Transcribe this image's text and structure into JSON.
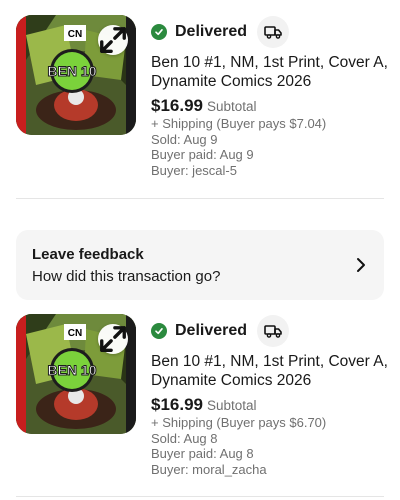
{
  "orders": [
    {
      "status": "Delivered",
      "title": "Ben 10 #1, NM, 1st Print, Cover A, Dynamite Comics 2026",
      "price": "$16.99",
      "price_label": "Subtotal",
      "shipping": "+ Shipping (Buyer pays $7.04)",
      "sold": "Sold: Aug 9",
      "paid": "Buyer paid: Aug 9",
      "buyer": "Buyer: jescal-5",
      "image_text": {
        "brand": "CN",
        "logo": "BEN 10"
      }
    },
    {
      "status": "Delivered",
      "title": "Ben 10 #1, NM, 1st Print, Cover A, Dynamite Comics 2026",
      "price": "$16.99",
      "price_label": "Subtotal",
      "shipping": "+ Shipping (Buyer pays $6.70)",
      "sold": "Sold: Aug 8",
      "paid": "Buyer paid: Aug 8",
      "buyer": "Buyer: moral_zacha",
      "image_text": {
        "brand": "CN",
        "logo": "BEN 10"
      }
    }
  ],
  "feedback": {
    "title": "Leave feedback",
    "subtitle": "How did this transaction go?"
  },
  "icons": {
    "status": "check-circle-icon",
    "tracking": "truck-icon",
    "expand": "expand-icon",
    "feedback_arrow": "chevron-right-icon"
  },
  "colors": {
    "delivered_green": "#2b8a3e",
    "text_primary": "#191919",
    "text_secondary": "#707070",
    "card_bg": "#f5f5f5"
  }
}
